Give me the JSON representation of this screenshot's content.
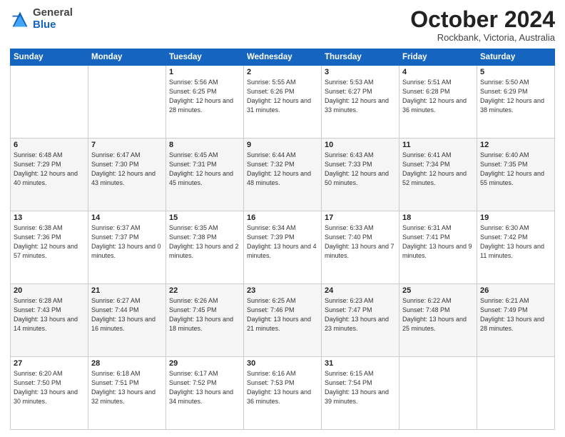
{
  "header": {
    "logo_general": "General",
    "logo_blue": "Blue",
    "month": "October 2024",
    "location": "Rockbank, Victoria, Australia"
  },
  "days_of_week": [
    "Sunday",
    "Monday",
    "Tuesday",
    "Wednesday",
    "Thursday",
    "Friday",
    "Saturday"
  ],
  "weeks": [
    [
      {
        "day": "",
        "info": ""
      },
      {
        "day": "",
        "info": ""
      },
      {
        "day": "1",
        "info": "Sunrise: 5:56 AM\nSunset: 6:25 PM\nDaylight: 12 hours\nand 28 minutes."
      },
      {
        "day": "2",
        "info": "Sunrise: 5:55 AM\nSunset: 6:26 PM\nDaylight: 12 hours\nand 31 minutes."
      },
      {
        "day": "3",
        "info": "Sunrise: 5:53 AM\nSunset: 6:27 PM\nDaylight: 12 hours\nand 33 minutes."
      },
      {
        "day": "4",
        "info": "Sunrise: 5:51 AM\nSunset: 6:28 PM\nDaylight: 12 hours\nand 36 minutes."
      },
      {
        "day": "5",
        "info": "Sunrise: 5:50 AM\nSunset: 6:29 PM\nDaylight: 12 hours\nand 38 minutes."
      }
    ],
    [
      {
        "day": "6",
        "info": "Sunrise: 6:48 AM\nSunset: 7:29 PM\nDaylight: 12 hours\nand 40 minutes."
      },
      {
        "day": "7",
        "info": "Sunrise: 6:47 AM\nSunset: 7:30 PM\nDaylight: 12 hours\nand 43 minutes."
      },
      {
        "day": "8",
        "info": "Sunrise: 6:45 AM\nSunset: 7:31 PM\nDaylight: 12 hours\nand 45 minutes."
      },
      {
        "day": "9",
        "info": "Sunrise: 6:44 AM\nSunset: 7:32 PM\nDaylight: 12 hours\nand 48 minutes."
      },
      {
        "day": "10",
        "info": "Sunrise: 6:43 AM\nSunset: 7:33 PM\nDaylight: 12 hours\nand 50 minutes."
      },
      {
        "day": "11",
        "info": "Sunrise: 6:41 AM\nSunset: 7:34 PM\nDaylight: 12 hours\nand 52 minutes."
      },
      {
        "day": "12",
        "info": "Sunrise: 6:40 AM\nSunset: 7:35 PM\nDaylight: 12 hours\nand 55 minutes."
      }
    ],
    [
      {
        "day": "13",
        "info": "Sunrise: 6:38 AM\nSunset: 7:36 PM\nDaylight: 12 hours\nand 57 minutes."
      },
      {
        "day": "14",
        "info": "Sunrise: 6:37 AM\nSunset: 7:37 PM\nDaylight: 13 hours\nand 0 minutes."
      },
      {
        "day": "15",
        "info": "Sunrise: 6:35 AM\nSunset: 7:38 PM\nDaylight: 13 hours\nand 2 minutes."
      },
      {
        "day": "16",
        "info": "Sunrise: 6:34 AM\nSunset: 7:39 PM\nDaylight: 13 hours\nand 4 minutes."
      },
      {
        "day": "17",
        "info": "Sunrise: 6:33 AM\nSunset: 7:40 PM\nDaylight: 13 hours\nand 7 minutes."
      },
      {
        "day": "18",
        "info": "Sunrise: 6:31 AM\nSunset: 7:41 PM\nDaylight: 13 hours\nand 9 minutes."
      },
      {
        "day": "19",
        "info": "Sunrise: 6:30 AM\nSunset: 7:42 PM\nDaylight: 13 hours\nand 11 minutes."
      }
    ],
    [
      {
        "day": "20",
        "info": "Sunrise: 6:28 AM\nSunset: 7:43 PM\nDaylight: 13 hours\nand 14 minutes."
      },
      {
        "day": "21",
        "info": "Sunrise: 6:27 AM\nSunset: 7:44 PM\nDaylight: 13 hours\nand 16 minutes."
      },
      {
        "day": "22",
        "info": "Sunrise: 6:26 AM\nSunset: 7:45 PM\nDaylight: 13 hours\nand 18 minutes."
      },
      {
        "day": "23",
        "info": "Sunrise: 6:25 AM\nSunset: 7:46 PM\nDaylight: 13 hours\nand 21 minutes."
      },
      {
        "day": "24",
        "info": "Sunrise: 6:23 AM\nSunset: 7:47 PM\nDaylight: 13 hours\nand 23 minutes."
      },
      {
        "day": "25",
        "info": "Sunrise: 6:22 AM\nSunset: 7:48 PM\nDaylight: 13 hours\nand 25 minutes."
      },
      {
        "day": "26",
        "info": "Sunrise: 6:21 AM\nSunset: 7:49 PM\nDaylight: 13 hours\nand 28 minutes."
      }
    ],
    [
      {
        "day": "27",
        "info": "Sunrise: 6:20 AM\nSunset: 7:50 PM\nDaylight: 13 hours\nand 30 minutes."
      },
      {
        "day": "28",
        "info": "Sunrise: 6:18 AM\nSunset: 7:51 PM\nDaylight: 13 hours\nand 32 minutes."
      },
      {
        "day": "29",
        "info": "Sunrise: 6:17 AM\nSunset: 7:52 PM\nDaylight: 13 hours\nand 34 minutes."
      },
      {
        "day": "30",
        "info": "Sunrise: 6:16 AM\nSunset: 7:53 PM\nDaylight: 13 hours\nand 36 minutes."
      },
      {
        "day": "31",
        "info": "Sunrise: 6:15 AM\nSunset: 7:54 PM\nDaylight: 13 hours\nand 39 minutes."
      },
      {
        "day": "",
        "info": ""
      },
      {
        "day": "",
        "info": ""
      }
    ]
  ]
}
